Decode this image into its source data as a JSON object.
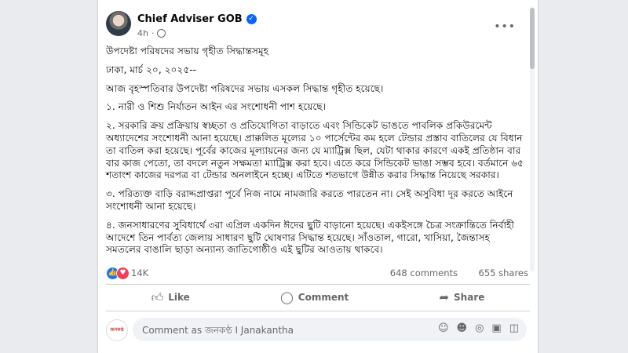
{
  "post": {
    "author": "Chief Adviser GOB",
    "time": "4h",
    "more_icon": "more-horizontal-icon",
    "paragraphs": [
      "উপদেষ্টা পরিষদের সভায় গৃহীত সিদ্ধান্তসমূহ",
      "ঢাকা, মার্চ ২০, ২০২৫--",
      "আজ বৃহস্পতিবার উপদেষ্টা পরিষদের সভায় এসকল সিদ্ধান্ত গৃহীত হয়েছে।",
      "১. নারী ও শিশু নির্যাতন আইন এর সংশোধনী পাশ হয়েছে।",
      "২. সরকারি ক্রয় প্রক্রিয়ায় স্বচ্ছতা ও প্রতিযোগিতা বাড়াতে এবং সিন্ডিকেট ভাঙতে পাবলিক প্রকিউরমেন্ট অধ্যাদেশের সংশোধনী আনা হয়েছে। প্রাক্কলিত মূল্যের ১০ পার্সেন্টের কম হলে টেন্ডার প্রস্তাব বাতিলের যে বিধান তা বাতিল করা হয়েছে। পূর্বের কাজের মূল্যায়নের জন্য যে ম্যাট্রিক্স ছিল, যেটা থাকার কারণে একই প্রতিষ্ঠান বার বার কাজ পেতো, তা বদলে নতুন সক্ষমতা ম্যাট্রিক্স করা হবে। এতে করে সিন্ডিকেট ভাঙা সম্ভব হবে। বর্তমানে ৬৫ শতাংশ কাজের দরপত্র বা টেন্ডার অনলাইনে হচ্ছে। এটিতে শতভাগে উন্নীত করার সিদ্ধান্ত নিয়েছে সরকার।",
      "৩. পরিত্যক্ত বাড়ি বরাদ্দপ্রাপ্তরা পূর্বে নিজ নামে নামজারি করতে পারতেন না। সেই অসুবিধা দূর করতে আইনে সংশোধনী আনা হয়েছে।",
      "৪. জনসাধারণের সুবিধার্থে ৩রা এপ্রিল একদিন ঈদের ছুটি বাড়ানো হয়েছে। একইসঙ্গে চৈত্র সংক্রান্তিতে নির্বাহী আদেশে তিন পার্বত্য জেলায় সাধারণ ছুটি ঘোষণার সিদ্ধান্ত হয়েছে। সাঁওতাল, গারো, খাসিয়া, জৈন্তাসহ সমতলের বাঙালি ছাড়া অন্যান্য জাতিগোষ্ঠীও এই ছুটির আওতায় থাকবে।"
    ]
  },
  "stats": {
    "reactions": "14K",
    "comments": "648 comments",
    "shares": "655 shares"
  },
  "actions": {
    "like": "Like",
    "comment": "Comment",
    "share": "Share"
  },
  "comment_box": {
    "placeholder": "Comment as জনকণ্ঠ I Janakantha"
  },
  "colors": {
    "accent": "#0866ff",
    "love": "#f33e58",
    "background": "#e9ebee"
  }
}
